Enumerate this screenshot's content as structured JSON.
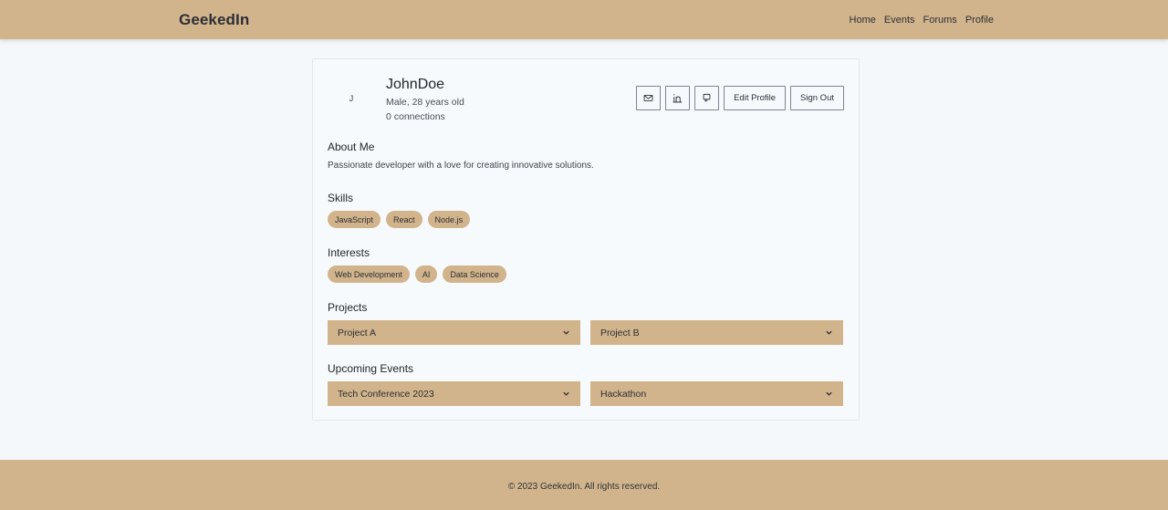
{
  "brand": "GeekedIn",
  "nav": {
    "home": "Home",
    "events": "Events",
    "forums": "Forums",
    "profile": "Profile"
  },
  "profile": {
    "avatar_initial": "J",
    "name": "JohnDoe",
    "details": "Male, 28 years old",
    "connections": "0 connections"
  },
  "actions": {
    "icons": [
      "mail-icon",
      "linkedin-icon",
      "github-icon"
    ],
    "edit_label": "Edit Profile",
    "signout_label": "Sign Out"
  },
  "about": {
    "title": "About Me",
    "text": "Passionate developer with a love for creating innovative solutions."
  },
  "skills": {
    "title": "Skills",
    "items": [
      "JavaScript",
      "React",
      "Node.js"
    ]
  },
  "interests": {
    "title": "Interests",
    "items": [
      "Web Development",
      "AI",
      "Data Science"
    ]
  },
  "projects": {
    "title": "Projects",
    "items": [
      "Project A",
      "Project B"
    ]
  },
  "events": {
    "title": "Upcoming Events",
    "items": [
      "Tech Conference 2023",
      "Hackathon"
    ]
  },
  "footer": "© 2023 GeekedIn. All rights reserved.",
  "colors": {
    "accent": "#d2b48c",
    "background": "#f5f8fb",
    "text": "#2b2f36"
  }
}
